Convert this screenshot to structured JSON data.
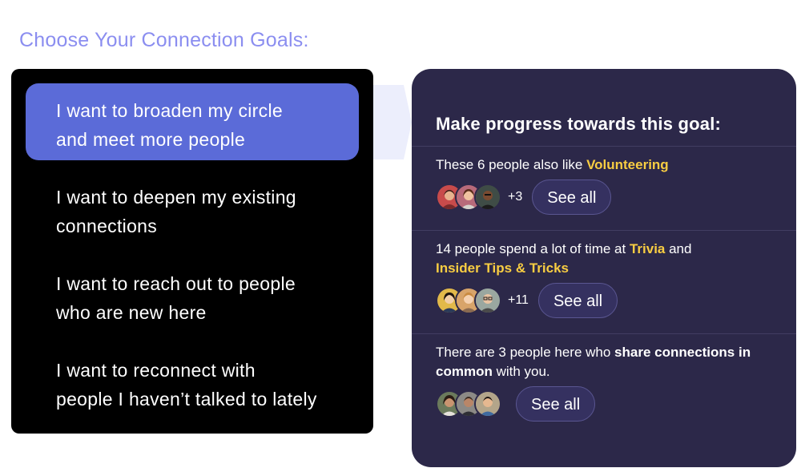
{
  "page_title": "Choose Your Connection Goals:",
  "goals": [
    {
      "line1": "I want to broaden my circle",
      "line2": "and meet more people",
      "selected": true
    },
    {
      "line1": "I want to deepen my existing",
      "line2": "connections",
      "selected": false
    },
    {
      "line1": "I want to reach out to people",
      "line2": "who are new here",
      "selected": false
    },
    {
      "line1": "I want to reconnect with",
      "line2": "people I haven’t talked to lately",
      "selected": false
    }
  ],
  "progress": {
    "heading": "Make progress towards this goal:",
    "suggestions": [
      {
        "text_before": "These 6 people also like ",
        "highlight1": "Volunteering",
        "more_count": "+3",
        "see_all_label": "See all"
      },
      {
        "text_before": "14 people spend a lot of time at ",
        "highlight1": "Trivia",
        "text_middle": " and",
        "highlight2": "Insider Tips & Tricks",
        "more_count": "+11",
        "see_all_label": "See all"
      },
      {
        "text_before": "There are 3 people here who ",
        "bold": "share connections in common",
        "text_after": " with you.",
        "see_all_label": "See all"
      }
    ]
  },
  "colors": {
    "title": "#8b8ef0",
    "selected_goal": "#5b6bd8",
    "panel_dark": "#2c2849",
    "highlight": "#f8cd42"
  }
}
